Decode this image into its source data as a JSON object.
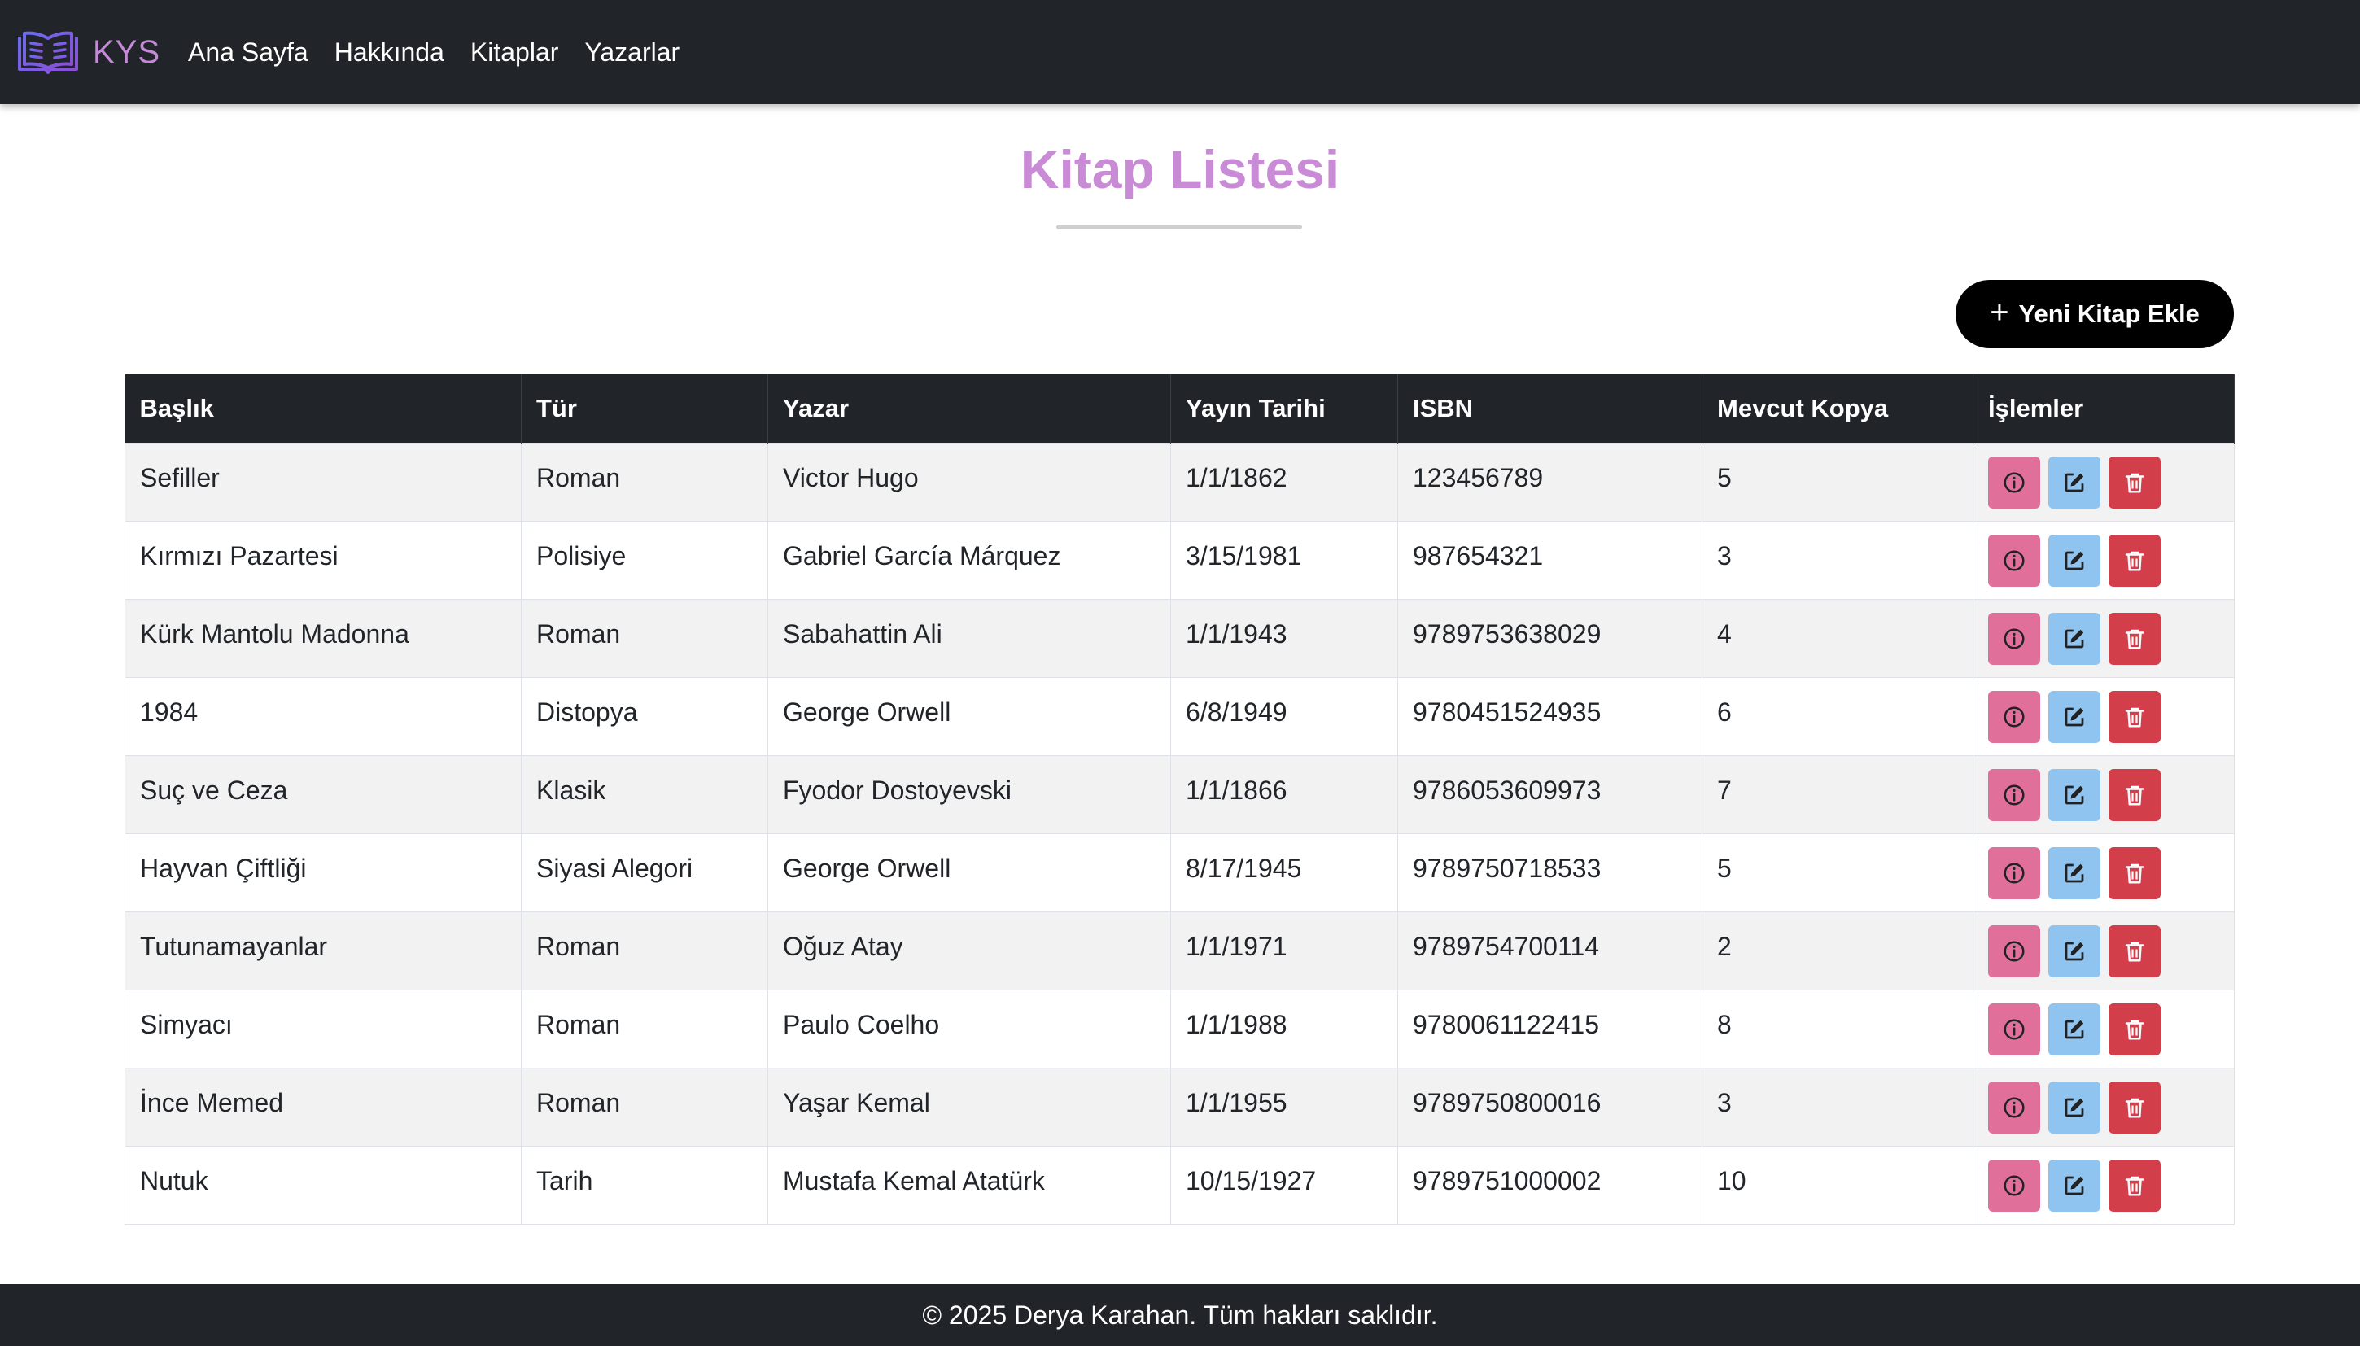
{
  "nav": {
    "brand": "KYS",
    "links": [
      "Ana Sayfa",
      "Hakkında",
      "Kitaplar",
      "Yazarlar"
    ]
  },
  "page": {
    "title": "Kitap Listesi",
    "add_button": "Yeni Kitap Ekle"
  },
  "table": {
    "headers": [
      "Başlık",
      "Tür",
      "Yazar",
      "Yayın Tarihi",
      "ISBN",
      "Mevcut Kopya",
      "İşlemler"
    ],
    "rows": [
      [
        "Sefiller",
        "Roman",
        "Victor Hugo",
        "1/1/1862",
        "123456789",
        "5"
      ],
      [
        "Kırmızı Pazartesi",
        "Polisiye",
        "Gabriel García Márquez",
        "3/15/1981",
        "987654321",
        "3"
      ],
      [
        "Kürk Mantolu Madonna",
        "Roman",
        "Sabahattin Ali",
        "1/1/1943",
        "9789753638029",
        "4"
      ],
      [
        "1984",
        "Distopya",
        "George Orwell",
        "6/8/1949",
        "9780451524935",
        "6"
      ],
      [
        "Suç ve Ceza",
        "Klasik",
        "Fyodor Dostoyevski",
        "1/1/1866",
        "9786053609973",
        "7"
      ],
      [
        "Hayvan Çiftliği",
        "Siyasi Alegori",
        "George Orwell",
        "8/17/1945",
        "9789750718533",
        "5"
      ],
      [
        "Tutunamayanlar",
        "Roman",
        "Oğuz Atay",
        "1/1/1971",
        "9789754700114",
        "2"
      ],
      [
        "Simyacı",
        "Roman",
        "Paulo Coelho",
        "1/1/1988",
        "9780061122415",
        "8"
      ],
      [
        "İnce Memed",
        "Roman",
        "Yaşar Kemal",
        "1/1/1955",
        "9789750800016",
        "3"
      ],
      [
        "Nutuk",
        "Tarih",
        "Mustafa Kemal Atatürk",
        "10/15/1927",
        "9789751000002",
        "10"
      ]
    ]
  },
  "icons": {
    "brand": "open-book-icon",
    "add": "plus-icon",
    "info": "info-circle-icon",
    "edit": "edit-icon",
    "delete": "trash-icon"
  },
  "colors": {
    "navbar": "#212529",
    "brand": "#c58ad8",
    "title": "#c98bd6",
    "info_btn": "#e0709a",
    "edit_btn": "#8fc3f0",
    "delete_btn": "#d23f4a"
  },
  "footer": {
    "text": "© 2025 Derya Karahan. Tüm hakları saklıdır."
  }
}
